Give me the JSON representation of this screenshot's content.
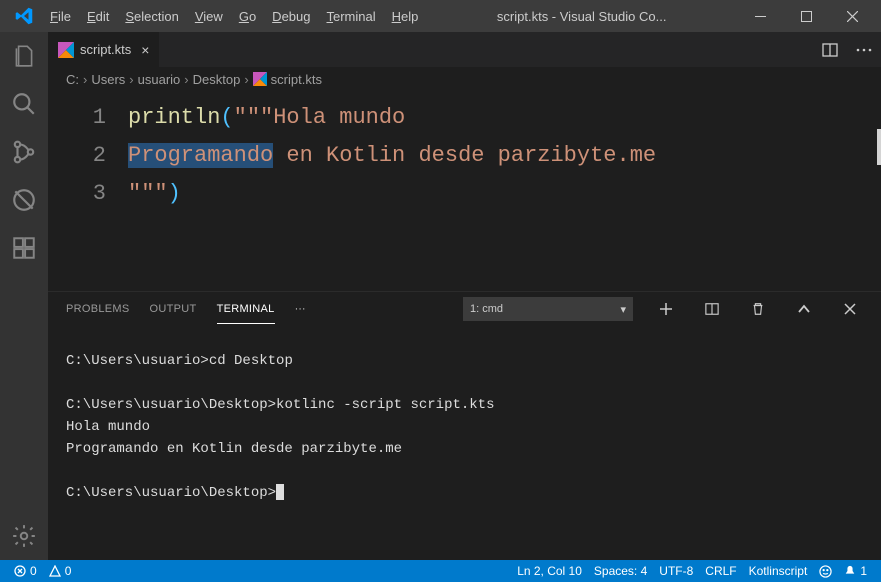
{
  "title": "script.kts - Visual Studio Co...",
  "menu": [
    "File",
    "Edit",
    "Selection",
    "View",
    "Go",
    "Debug",
    "Terminal",
    "Help"
  ],
  "tab": {
    "filename": "script.kts"
  },
  "breadcrumb": [
    "C:",
    "Users",
    "usuario",
    "Desktop",
    "script.kts"
  ],
  "code": {
    "line1_fn": "println",
    "line1_open": "(",
    "line1_quotes": "\"\"\"",
    "line1_str": "Hola mundo",
    "line2_sel": "Programando",
    "line2_rest": " en Kotlin desde parzibyte.me",
    "line3_quotes": "\"\"\"",
    "line3_close": ")",
    "lineNumbers": [
      "1",
      "2",
      "3"
    ]
  },
  "panel": {
    "tabs": [
      "PROBLEMS",
      "OUTPUT",
      "TERMINAL"
    ],
    "activeTab": "TERMINAL",
    "terminalLabel": "1: cmd"
  },
  "terminal": {
    "line1_prompt": "C:\\Users\\usuario>",
    "line1_cmd": "cd Desktop",
    "line2_prompt": "C:\\Users\\usuario\\Desktop>",
    "line2_cmd": "kotlinc -script script.kts",
    "line3": "Hola mundo",
    "line4": "Programando en Kotlin desde parzibyte.me",
    "line5_prompt": "C:\\Users\\usuario\\Desktop>"
  },
  "status": {
    "errors": "0",
    "warnings": "0",
    "lncol": "Ln 2, Col 10",
    "spaces": "Spaces: 4",
    "encoding": "UTF-8",
    "eol": "CRLF",
    "lang": "Kotlinscript",
    "bell": "1"
  }
}
